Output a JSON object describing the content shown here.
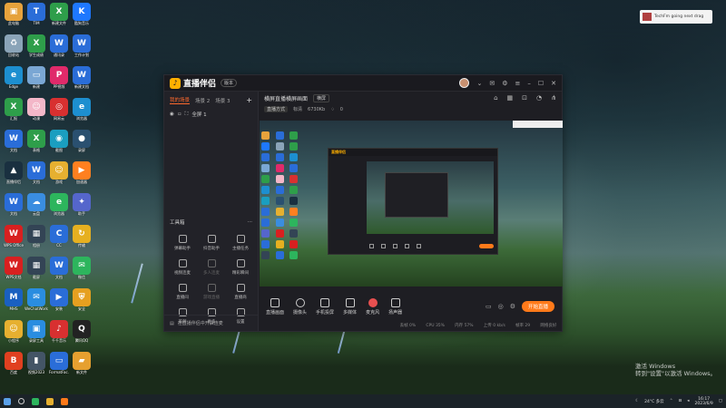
{
  "desktop": {
    "icons": [
      {
        "label": "此电脑",
        "color": "#e6a23c",
        "g": "▣"
      },
      {
        "label": "TIM",
        "color": "#2a6dd8",
        "g": "T"
      },
      {
        "label": "新建文件",
        "color": "#2e9e4a",
        "g": "X"
      },
      {
        "label": "酷狗音乐",
        "color": "#1e78ff",
        "g": "K"
      },
      {
        "label": "回收站",
        "color": "#8aa4b8",
        "g": "♻"
      },
      {
        "label": "学生成绩",
        "color": "#2e9e4a",
        "g": "X"
      },
      {
        "label": "通讯录",
        "color": "#2a6dd8",
        "g": "W"
      },
      {
        "label": "工作计划",
        "color": "#2a6dd8",
        "g": "W"
      },
      {
        "label": "Edge",
        "color": "#1d8fd0",
        "g": "e"
      },
      {
        "label": "新建",
        "color": "#7aa7d4",
        "g": "▭"
      },
      {
        "label": "PP视频",
        "color": "#e02a6a",
        "g": "P"
      },
      {
        "label": "新建文档",
        "color": "#2a6dd8",
        "g": "W"
      },
      {
        "label": "汇报",
        "color": "#2e9e4a",
        "g": "X"
      },
      {
        "label": "动漫",
        "color": "#f3b7c8",
        "g": "☺"
      },
      {
        "label": "网易云",
        "color": "#d83030",
        "g": "◎"
      },
      {
        "label": "浏览器",
        "color": "#1d8fd0",
        "g": "e"
      },
      {
        "label": "文档",
        "color": "#2a6dd8",
        "g": "W"
      },
      {
        "label": "表格",
        "color": "#2e9e4a",
        "g": "X"
      },
      {
        "label": "截图",
        "color": "#1a9ec0",
        "g": "◉"
      },
      {
        "label": "录屏",
        "color": "#2a5070",
        "g": "●"
      },
      {
        "label": "直播伴侣",
        "color": "#1a3040",
        "g": "▲"
      },
      {
        "label": "文档",
        "color": "#2a6dd8",
        "g": "W"
      },
      {
        "label": "游戏",
        "color": "#e6b030",
        "g": "☺"
      },
      {
        "label": "加速器",
        "color": "#ff8020",
        "g": "▶"
      },
      {
        "label": "文档",
        "color": "#2a6dd8",
        "g": "W"
      },
      {
        "label": "云盘",
        "color": "#3a8de0",
        "g": "☁"
      },
      {
        "label": "浏览器",
        "color": "#2db55d",
        "g": "e"
      },
      {
        "label": "助手",
        "color": "#5566cc",
        "g": "✦"
      },
      {
        "label": "WPS Office",
        "color": "#d82020",
        "g": "W"
      },
      {
        "label": "相册",
        "color": "#334455",
        "g": "▦"
      },
      {
        "label": "CC",
        "color": "#2a6dd8",
        "g": "C"
      },
      {
        "label": "传输",
        "color": "#e6b020",
        "g": "↻"
      },
      {
        "label": "WPS文档",
        "color": "#d82020",
        "g": "W"
      },
      {
        "label": "截屏",
        "color": "#334455",
        "g": "▦"
      },
      {
        "label": "文档",
        "color": "#2a6dd8",
        "g": "W"
      },
      {
        "label": "微信",
        "color": "#2db55d",
        "g": "✉"
      },
      {
        "label": "MHS",
        "color": "#1a60c0",
        "g": "M"
      },
      {
        "label": "WeChatWork",
        "color": "#2a8de0",
        "g": "✉"
      },
      {
        "label": "安装",
        "color": "#2a6dd8",
        "g": "▶"
      },
      {
        "label": "安全",
        "color": "#e6a020",
        "g": "⛨"
      },
      {
        "label": "小程序",
        "color": "#e6b030",
        "g": "☺"
      },
      {
        "label": "录屏工具",
        "color": "#2a8de0",
        "g": "▣"
      },
      {
        "label": "千千音乐",
        "color": "#d83030",
        "g": "♪"
      },
      {
        "label": "腾讯QQ",
        "color": "#222222",
        "g": "Q"
      },
      {
        "label": "百度",
        "color": "#e04020",
        "g": "B"
      },
      {
        "label": "视频2023",
        "color": "#445566",
        "g": "▮"
      },
      {
        "label": "FormatFac.",
        "color": "#2a6dd8",
        "g": "▭"
      },
      {
        "label": "新文件",
        "color": "#e6a030",
        "g": "▰"
      }
    ],
    "notification_text": "TechFm going next drag",
    "watermark_line1": "激活 Windows",
    "watermark_line2": "转到\"设置\"以激活 Windows。"
  },
  "app": {
    "title": "直播伴侣",
    "version": "版本",
    "scene_tabs": [
      "我的场景",
      "场景 2",
      "场景 3"
    ],
    "add_scene": "+",
    "scene_item": "全屏 1",
    "tools_header": "工具箱",
    "tools_more": "…",
    "tools": [
      {
        "label": "弹幕助手",
        "dim": false
      },
      {
        "label": "抖音助手",
        "dim": false
      },
      {
        "label": "主播任务",
        "dim": false
      },
      {
        "label": "视频连麦",
        "dim": false
      },
      {
        "label": "多人连麦",
        "dim": true
      },
      {
        "label": "精彩瞬间",
        "dim": false
      },
      {
        "label": "直播间",
        "dim": false
      },
      {
        "label": "游戏直播",
        "dim": true
      },
      {
        "label": "直播商",
        "dim": false
      },
      {
        "label": "美颜",
        "dim": false
      },
      {
        "label": "更多",
        "dim": false
      },
      {
        "label": "设置",
        "dim": false
      }
    ],
    "left_footer": "在直播伴侣中开启连麦",
    "main_tab": "横屏直播横屏画面",
    "main_tab_chip": "横屏",
    "info_chip": "直播方式",
    "info_resolution": "标清",
    "info_bitrate": "6730Kb",
    "info_viewers": "0",
    "controls": [
      "直播画面",
      "摄像头",
      "手机投屏",
      "多媒体",
      "麦克风",
      "扬声器"
    ],
    "go_live": "开始直播",
    "stats": [
      "丢帧 0%",
      "CPU 35%",
      "内存 57%",
      "上传 0 kb/s",
      "帧率 29",
      "网络良好"
    ]
  },
  "taskbar": {
    "weather": "24°C 多云",
    "time": "16:17",
    "date": "2023/6/9"
  }
}
